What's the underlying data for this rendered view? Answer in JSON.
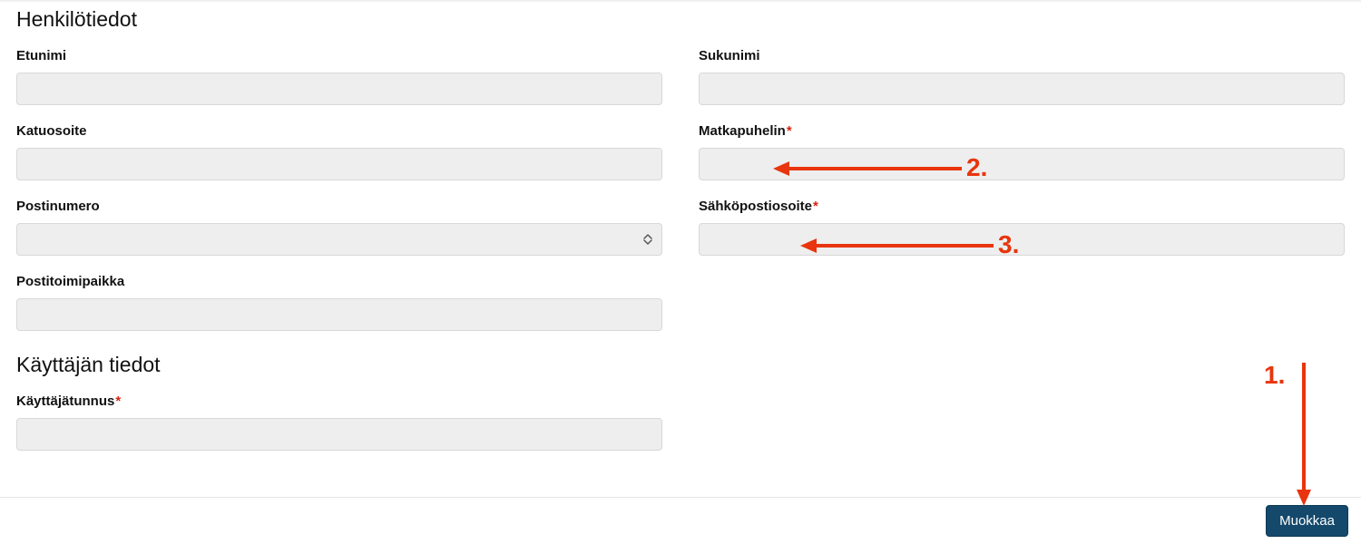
{
  "sections": {
    "personal": {
      "title": "Henkilötiedot",
      "fields": {
        "firstname": {
          "label": "Etunimi",
          "value": "",
          "required": false
        },
        "lastname": {
          "label": "Sukunimi",
          "value": "",
          "required": false
        },
        "street": {
          "label": "Katuosoite",
          "value": "",
          "required": false
        },
        "mobile": {
          "label": "Matkapuhelin",
          "value": "",
          "required": true
        },
        "postalcode": {
          "label": "Postinumero",
          "value": "",
          "required": false
        },
        "email": {
          "label": "Sähköpostiosoite",
          "value": "",
          "required": true
        },
        "city": {
          "label": "Postitoimipaikka",
          "value": "",
          "required": false
        }
      }
    },
    "user": {
      "title": "Käyttäjän tiedot",
      "fields": {
        "username": {
          "label": "Käyttäjätunnus",
          "value": "",
          "required": true
        }
      }
    }
  },
  "footer": {
    "edit_label": "Muokkaa"
  },
  "annotations": {
    "a1": "1.",
    "a2": "2.",
    "a3": "3."
  },
  "colors": {
    "required_asterisk": "#d9230f",
    "annotation": "#e8350d",
    "button_bg": "#14496c"
  }
}
